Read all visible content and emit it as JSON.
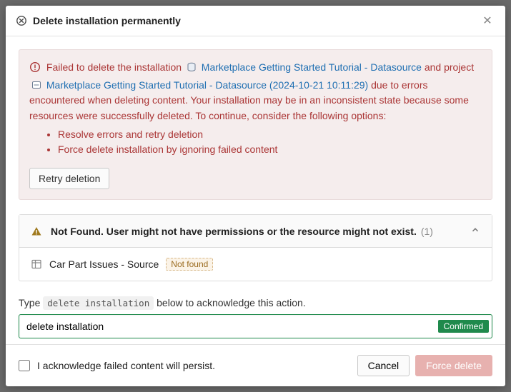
{
  "dialog": {
    "title": "Delete installation permanently"
  },
  "error": {
    "prefix": "Failed to delete the installation",
    "link1": "Marketplace Getting Started Tutorial - Datasource",
    "mid": "and project",
    "link2": "Marketplace Getting Started Tutorial - Datasource (2024-10-21 10:11:29)",
    "rest": "due to errors encountered when deleting content. Your installation may be in an inconsistent state because some resources were successfully deleted. To continue, consider the following options:",
    "options": [
      "Resolve errors and retry deletion",
      "Force delete installation by ignoring failed content"
    ],
    "retry_label": "Retry deletion"
  },
  "notfound": {
    "title": "Not Found. User might not have permissions or the resource might not exist.",
    "count": "(1)",
    "item": "Car Part Issues - Source",
    "badge": "Not found"
  },
  "ack": {
    "prefix": "Type",
    "code": "delete installation",
    "suffix": "below to acknowledge this action.",
    "input_value": "delete installation",
    "confirmed": "Confirmed"
  },
  "footer": {
    "checkbox_label": "I acknowledge failed content will persist.",
    "cancel": "Cancel",
    "force": "Force delete"
  }
}
